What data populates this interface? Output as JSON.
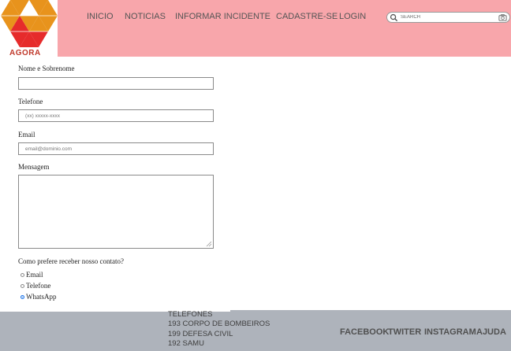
{
  "brand": {
    "name": "AGORA",
    "colors": {
      "orange": "#e8931c",
      "red": "#e62b2b",
      "header_pink": "#f8a6ab",
      "footer_gray": "#aeb3bb"
    }
  },
  "nav": {
    "items": [
      {
        "label": "INICIO"
      },
      {
        "label": "NOTICIAS"
      },
      {
        "label": "INFORMAR INCIDENTE"
      },
      {
        "label": "CADASTRE-SE"
      },
      {
        "label": "LOGIN"
      }
    ]
  },
  "search": {
    "placeholder": "SEARCH",
    "icon": "search-icon",
    "secondary_icon": "camera-icon"
  },
  "form": {
    "name_label": "Nome e Sobrenome",
    "name_value": "",
    "phone_label": "Telefone",
    "phone_placeholder": "(xx) xxxxx-xxxx",
    "email_label": "Email",
    "email_placeholder": "email@dominio.com",
    "message_label": "Mensagem",
    "contact_question": "Como prefere receber nosso contato?",
    "contact_options": [
      {
        "label": "Email",
        "checked": false
      },
      {
        "label": "Telefone",
        "checked": false
      },
      {
        "label": "WhatsApp",
        "checked": true
      }
    ]
  },
  "footer": {
    "phones_title": "TELEFONES",
    "phones": [
      "193 CORPO DE BOMBEIROS",
      "199 DEFESA CIVIL",
      "192 SAMU"
    ],
    "social": [
      {
        "label": "FACEBOOK"
      },
      {
        "label": "TWITER"
      },
      {
        "label": "INSTAGRAM"
      },
      {
        "label": "AJUDA"
      }
    ]
  }
}
